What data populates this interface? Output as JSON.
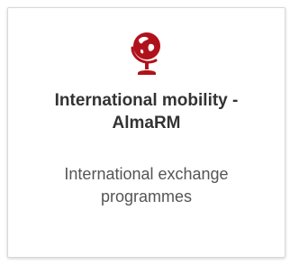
{
  "tile": {
    "icon": "globe-icon",
    "title": "International mobility -\nAlmaRM",
    "subtitle": "International exchange\nprogrammes"
  },
  "colors": {
    "accent": "#b0121b",
    "title_text": "#333333",
    "subtitle_text": "#555555",
    "border": "#d9d9d9"
  }
}
